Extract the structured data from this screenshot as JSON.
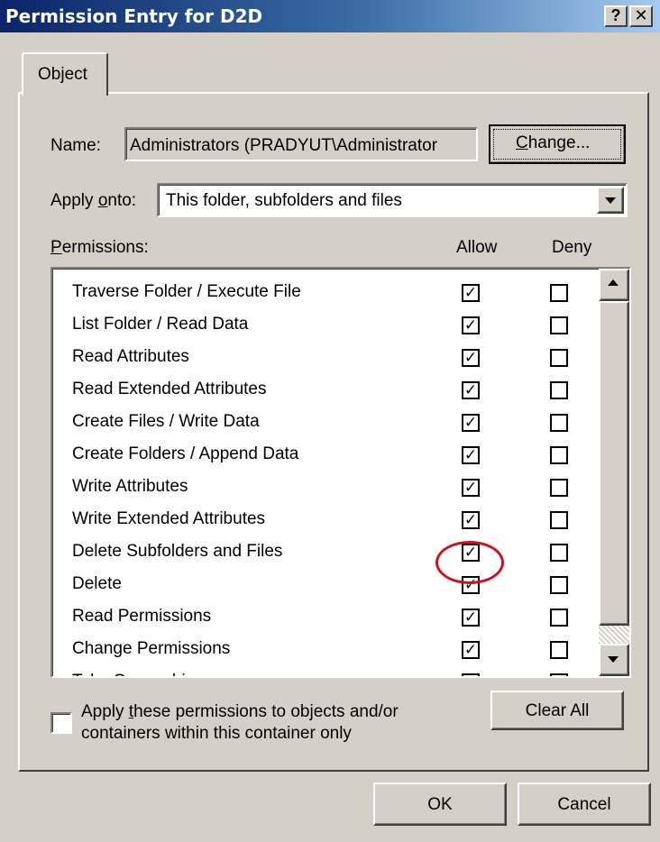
{
  "window": {
    "title": "Permission Entry for D2D",
    "help_label": "?",
    "close_label": "✕"
  },
  "tab": {
    "label": "Object"
  },
  "name_field": {
    "label": "Name:",
    "value": "Administrators (PRADYUT\\Administrator",
    "change_button": {
      "underline": "C",
      "rest": "hange..."
    }
  },
  "apply_onto": {
    "label_pre": "Apply ",
    "label_underline": "o",
    "label_post": "nto:",
    "value": "This folder, subfolders and files"
  },
  "permissions": {
    "label_underline": "P",
    "label_rest": "ermissions:",
    "allow_header": "Allow",
    "deny_header": "Deny",
    "items": [
      {
        "label": "Traverse Folder / Execute File",
        "allow": true,
        "deny": false
      },
      {
        "label": "List Folder / Read Data",
        "allow": true,
        "deny": false
      },
      {
        "label": "Read Attributes",
        "allow": true,
        "deny": false
      },
      {
        "label": "Read Extended Attributes",
        "allow": true,
        "deny": false
      },
      {
        "label": "Create Files / Write Data",
        "allow": true,
        "deny": false
      },
      {
        "label": "Create Folders / Append Data",
        "allow": true,
        "deny": false
      },
      {
        "label": "Write Attributes",
        "allow": true,
        "deny": false
      },
      {
        "label": "Write Extended Attributes",
        "allow": true,
        "deny": false
      },
      {
        "label": "Delete Subfolders and Files",
        "allow": true,
        "deny": false
      },
      {
        "label": "Delete",
        "allow": true,
        "deny": false,
        "highlighted": true
      },
      {
        "label": "Read Permissions",
        "allow": true,
        "deny": false
      },
      {
        "label": "Change Permissions",
        "allow": true,
        "deny": false
      },
      {
        "label": "Take Ownership",
        "allow": true,
        "deny": false
      }
    ]
  },
  "apply_only": {
    "checked": false,
    "line1_pre": "Apply ",
    "line1_underline": "t",
    "line1_post": "hese permissions to objects and/or",
    "line2": "containers within this container only"
  },
  "buttons": {
    "clear_all": "Clear All",
    "ok": "OK",
    "cancel": "Cancel"
  },
  "colors": {
    "title_bar_start": "#0a246a",
    "title_bar_end": "#a6caf0",
    "dialog_face": "#d4d0c8",
    "highlight_circle": "#d0101a"
  },
  "icons": {
    "check_mark": "✓",
    "dropdown": "chevron-down-icon",
    "scroll_up": "chevron-up-icon",
    "scroll_down": "chevron-down-icon"
  }
}
